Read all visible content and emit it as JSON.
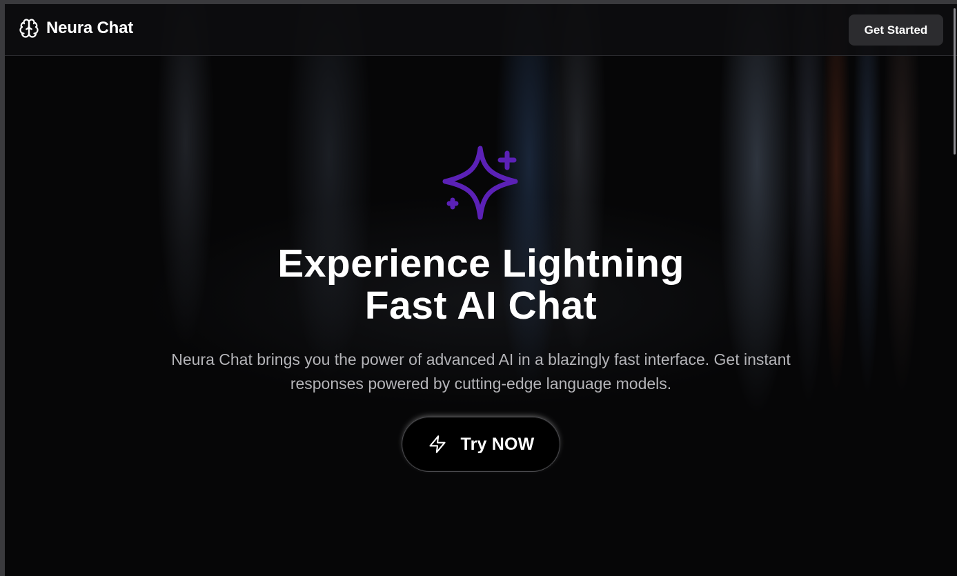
{
  "app": {
    "name": "Neura Chat",
    "logo_icon": "brain-icon"
  },
  "navbar": {
    "cta_label": "Get Started"
  },
  "hero": {
    "icon": "sparkles-icon",
    "icon_color": "#5b21b6",
    "title_line1": "Experience Lightning",
    "title_line2": "Fast AI Chat",
    "subtitle": "Neura Chat brings you the power of advanced AI in a blazingly fast interface. Get instant responses powered by cutting-edge language models.",
    "cta_label": "Try NOW",
    "cta_icon": "lightning-bolt-icon"
  },
  "colors": {
    "background": "#060607",
    "text_primary": "#ffffff",
    "text_secondary": "#b4b4b8",
    "nav_button_bg": "#2c2c2f"
  }
}
